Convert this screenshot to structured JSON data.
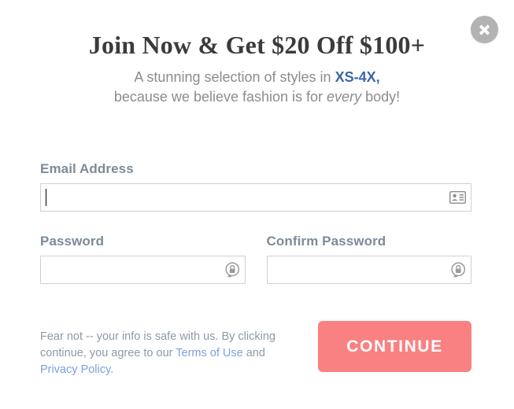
{
  "modal": {
    "close_label": "Close",
    "close_icon": "close-x-icon"
  },
  "header": {
    "headline": "Join Now & Get $20 Off $100+",
    "subline_1_pre": "A stunning selection of styles in ",
    "subline_1_highlight": "XS-4X,",
    "subline_2_pre": "because we believe fashion is for ",
    "subline_2_italic": "every",
    "subline_2_post": " body!"
  },
  "form": {
    "email": {
      "label": "Email Address",
      "value": "",
      "placeholder": "",
      "icon": "contact-card-icon",
      "focused": true
    },
    "password": {
      "label": "Password",
      "value": "",
      "placeholder": "",
      "icon": "password-key-icon"
    },
    "confirm_password": {
      "label": "Confirm Password",
      "value": "",
      "placeholder": "",
      "icon": "password-key-icon"
    }
  },
  "footer": {
    "disclaimer_part_1": "Fear not -- your info is safe with us. By clicking continue, you agree to our ",
    "terms_link": "Terms of Use",
    "disclaimer_and": " and ",
    "privacy_link": "Privacy Policy",
    "disclaimer_end": ".",
    "continue_label": "CONTINUE"
  },
  "colors": {
    "accent_button": "#fa8181",
    "link": "#7b9fe0",
    "highlight_blue": "#3c66a8",
    "label_gray": "#7d8b98",
    "headline": "#3b3b3b",
    "close_circle": "#b3b3b3"
  }
}
